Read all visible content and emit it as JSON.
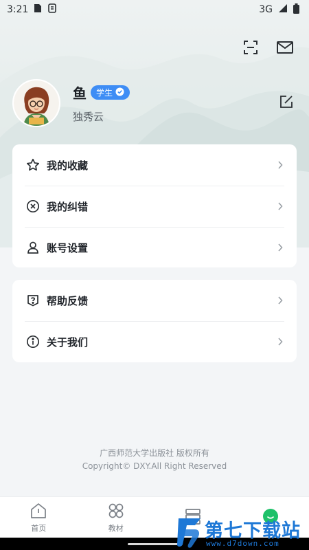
{
  "status_bar": {
    "time": "3:21",
    "network": "3G"
  },
  "profile": {
    "name": "鱼",
    "role_badge": "学生",
    "school": "独秀云"
  },
  "menu_group_1": [
    {
      "label": "我的收藏",
      "icon": "star-icon"
    },
    {
      "label": "我的纠错",
      "icon": "error-circle-icon"
    },
    {
      "label": "账号设置",
      "icon": "user-icon"
    }
  ],
  "menu_group_2": [
    {
      "label": "帮助反馈",
      "icon": "help-icon"
    },
    {
      "label": "关于我们",
      "icon": "info-icon"
    }
  ],
  "copyright": {
    "line1": "广西师范大学出版社 版权所有",
    "line2": "Copyright© DXY.All Right Reserved"
  },
  "bottom_nav": [
    {
      "label": "首页",
      "icon": "home-icon"
    },
    {
      "label": "教材",
      "icon": "textbook-icon"
    },
    {
      "label": "",
      "icon": "books-icon"
    },
    {
      "label": "",
      "icon": "me-icon",
      "active": true
    }
  ],
  "watermark": {
    "title": "第七下载站",
    "url": "www.d7down.com"
  },
  "colors": {
    "accent": "#1ec169",
    "badge": "#3e8df5",
    "watermark": "#1e78d6"
  }
}
